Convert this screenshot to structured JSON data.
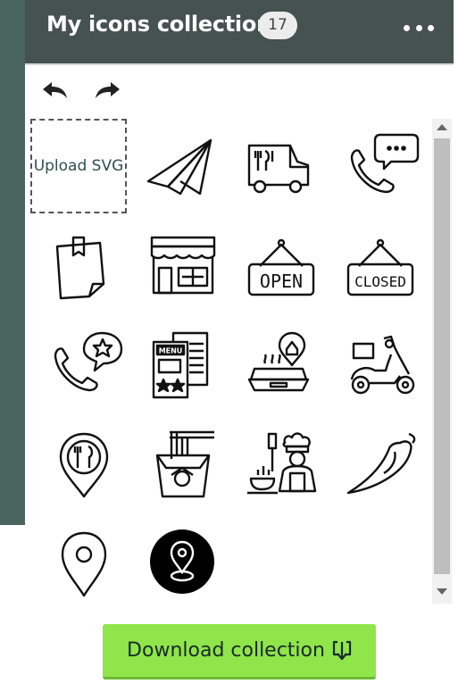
{
  "header": {
    "title": "My icons collection",
    "count": "17",
    "background": "#46524f"
  },
  "toolbar": {
    "undo_icon": "undo-arrow-icon",
    "redo_icon": "redo-arrow-icon"
  },
  "grid": {
    "upload_label": "Upload SVG",
    "icons": [
      "paper-plane-icon",
      "food-truck-icon",
      "phone-chat-icon",
      "sticky-note-icon",
      "restaurant-storefront-icon",
      "open-sign-icon",
      "closed-sign-icon",
      "phone-star-review-icon",
      "menu-rating-icon",
      "food-container-location-icon",
      "delivery-scooter-icon",
      "restaurant-location-pin-icon",
      "noodle-box-icon",
      "chef-cooking-icon",
      "chili-pepper-icon",
      "location-pin-icon",
      "location-pin-filled-circle-icon"
    ],
    "sign_open": "OPEN",
    "sign_closed": "CLOSED",
    "menu_text": "MENU"
  },
  "footer": {
    "download_label": "Download collection",
    "download_icon": "download-box-icon",
    "accent": "#8fe54a"
  }
}
